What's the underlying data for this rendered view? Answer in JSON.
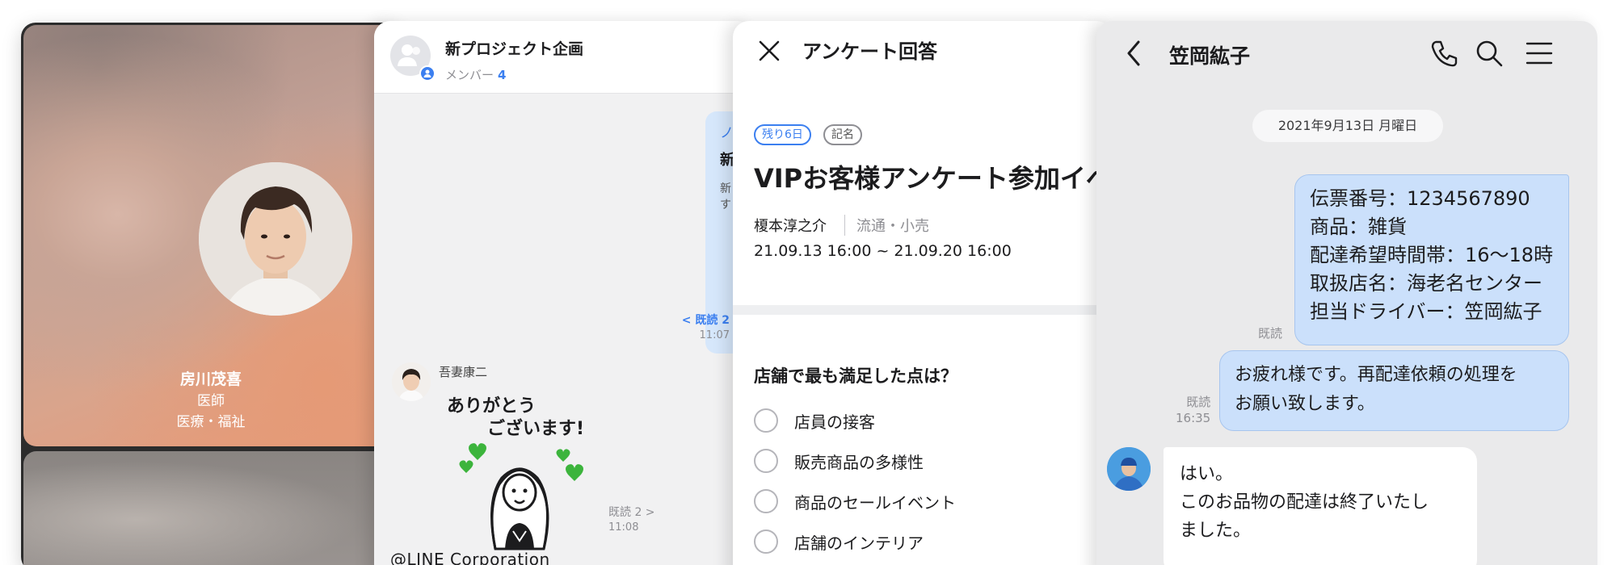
{
  "video_call": {
    "caller_name": "房川茂喜",
    "caller_role": "医師",
    "caller_industry": "医療・福祉"
  },
  "group_chat": {
    "title": "新プロジェクト企画",
    "members_label": "メンバー",
    "members_count": "4",
    "peek_line_a": "ノ",
    "peek_line_b": "新",
    "peek_line_c1": "新",
    "peek_line_c2": "す",
    "read_label_1": "< 既読 2",
    "read_time_1": "11:07",
    "sender_name": "吾妻康二",
    "sticker_text_1": "ありがとう",
    "sticker_text_2": "ございます!",
    "read_label_2": "既読 2 >",
    "read_time_2": "11:08",
    "copyright": "@LINE Corporation"
  },
  "survey": {
    "title": "アンケート回答",
    "tag_remaining": "残り6日",
    "tag_named": "記名",
    "heading": "VIPお客様アンケート参加イベ",
    "author": "榎本淳之介",
    "industry": "流通・小売",
    "period": "21.09.13 16:00 ~ 21.09.20 16:00",
    "question": "店舗で最も満足した点は？",
    "options": [
      "店員の接客",
      "販売商品の多様性",
      "商品のセールイベント",
      "店舗のインテリア"
    ]
  },
  "chat": {
    "contact_name": "笠岡紘子",
    "date": "2021年9月13日 月曜日",
    "message_1": [
      "伝票番号：1234567890",
      "商品：雑貨",
      "配達希望時間帯：16〜18時",
      "取扱店名：海老名センター",
      "担当ドライバー：笠岡紘子"
    ],
    "read_1": "既読",
    "message_2": [
      "お疲れ様です。再配達依頼の処理を",
      "お願い致します。"
    ],
    "read_2": "既読",
    "time_2": "16:35",
    "reply": [
      "はい。",
      "このお品物の配達は終了いたし",
      "ました。"
    ]
  },
  "colors": {
    "accent_blue": "#3b7ff0",
    "outgoing_bubble": "#cbe0fb",
    "chat_background": "#eaeaeb",
    "heart_green": "#3cb43c"
  },
  "icons": [
    "close-icon",
    "back-icon",
    "phone-icon",
    "search-icon",
    "menu-icon",
    "group-icon"
  ]
}
